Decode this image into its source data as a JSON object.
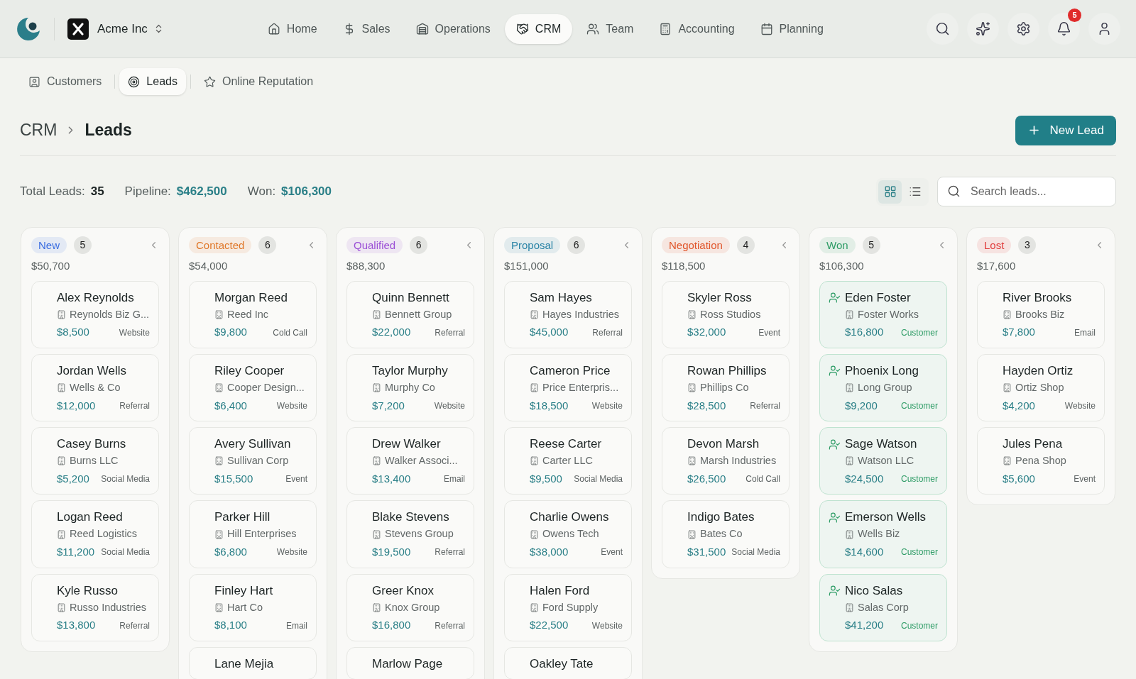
{
  "org": {
    "name": "Acme Inc"
  },
  "nav": [
    {
      "label": "Home",
      "kind": "home",
      "selected": false
    },
    {
      "label": "Sales",
      "kind": "dollar",
      "selected": false
    },
    {
      "label": "Operations",
      "kind": "warehouse",
      "selected": false
    },
    {
      "label": "CRM",
      "kind": "handshake",
      "selected": true
    },
    {
      "label": "Team",
      "kind": "users",
      "selected": false
    },
    {
      "label": "Accounting",
      "kind": "calculator",
      "selected": false
    },
    {
      "label": "Planning",
      "kind": "calendar",
      "selected": false
    }
  ],
  "notifications": {
    "count": "5"
  },
  "subnav": [
    {
      "label": "Customers",
      "kind": "contact",
      "selected": false
    },
    {
      "label": "Leads",
      "kind": "target",
      "selected": true
    },
    {
      "label": "Online Reputation",
      "kind": "star",
      "selected": false
    }
  ],
  "breadcrumb": [
    "CRM",
    "Leads"
  ],
  "new_button": "New Lead",
  "stats": [
    {
      "label": "Total Leads:",
      "value": "35",
      "kind": "plain"
    },
    {
      "label": "Pipeline:",
      "value": "$462,500",
      "kind": "money"
    },
    {
      "label": "Won:",
      "value": "$106,300",
      "kind": "money"
    }
  ],
  "view": [
    {
      "kind": "grid",
      "selected": true
    },
    {
      "kind": "list",
      "selected": false
    }
  ],
  "search": {
    "placeholder": "Search leads..."
  },
  "columns": [
    {
      "name": "New",
      "color": "#3b6ee0",
      "count": "5",
      "total": "$50,700",
      "cards": [
        {
          "name": "Alex Reynolds",
          "company": "Reynolds Biz G...",
          "value": "$8,500",
          "source": "Website",
          "converted": false
        },
        {
          "name": "Jordan Wells",
          "company": "Wells & Co",
          "value": "$12,000",
          "source": "Referral",
          "converted": false
        },
        {
          "name": "Casey Burns",
          "company": "Burns LLC",
          "value": "$5,200",
          "source": "Social Media",
          "converted": false
        },
        {
          "name": "Logan Reed",
          "company": "Reed Logistics",
          "value": "$11,200",
          "source": "Social Media",
          "converted": false
        },
        {
          "name": "Kyle Russo",
          "company": "Russo Industries",
          "value": "$13,800",
          "source": "Referral",
          "converted": false
        }
      ]
    },
    {
      "name": "Contacted",
      "color": "#e0782a",
      "count": "6",
      "total": "$54,000",
      "cards": [
        {
          "name": "Morgan Reed",
          "company": "Reed Inc",
          "value": "$9,800",
          "source": "Cold Call",
          "converted": false
        },
        {
          "name": "Riley Cooper",
          "company": "Cooper Design...",
          "value": "$6,400",
          "source": "Website",
          "converted": false
        },
        {
          "name": "Avery Sullivan",
          "company": "Sullivan Corp",
          "value": "$15,500",
          "source": "Event",
          "converted": false
        },
        {
          "name": "Parker Hill",
          "company": "Hill Enterprises",
          "value": "$6,800",
          "source": "Website",
          "converted": false
        },
        {
          "name": "Finley Hart",
          "company": "Hart Co",
          "value": "$8,100",
          "source": "Email",
          "converted": false
        },
        {
          "name": "Lane Mejia",
          "converted": false
        }
      ]
    },
    {
      "name": "Qualified",
      "color": "#9b4fd6",
      "count": "6",
      "total": "$88,300",
      "cards": [
        {
          "name": "Quinn Bennett",
          "company": "Bennett Group",
          "value": "$22,000",
          "source": "Referral",
          "converted": false
        },
        {
          "name": "Taylor Murphy",
          "company": "Murphy Co",
          "value": "$7,200",
          "source": "Website",
          "converted": false
        },
        {
          "name": "Drew Walker",
          "company": "Walker Associ...",
          "value": "$13,400",
          "source": "Email",
          "converted": false
        },
        {
          "name": "Blake Stevens",
          "company": "Stevens Group",
          "value": "$19,500",
          "source": "Referral",
          "converted": false
        },
        {
          "name": "Greer Knox",
          "company": "Knox Group",
          "value": "$16,800",
          "source": "Referral",
          "converted": false
        },
        {
          "name": "Marlow Page",
          "converted": false
        }
      ]
    },
    {
      "name": "Proposal",
      "color": "#2a84a6",
      "count": "6",
      "total": "$151,000",
      "cards": [
        {
          "name": "Sam Hayes",
          "company": "Hayes Industries",
          "value": "$45,000",
          "source": "Referral",
          "converted": false
        },
        {
          "name": "Cameron Price",
          "company": "Price Enterpris...",
          "value": "$18,500",
          "source": "Website",
          "converted": false
        },
        {
          "name": "Reese Carter",
          "company": "Carter LLC",
          "value": "$9,500",
          "source": "Social Media",
          "converted": false
        },
        {
          "name": "Charlie Owens",
          "company": "Owens Tech",
          "value": "$38,000",
          "source": "Event",
          "converted": false
        },
        {
          "name": "Halen Ford",
          "company": "Ford Supply",
          "value": "$22,500",
          "source": "Website",
          "converted": false
        },
        {
          "name": "Oakley Tate",
          "converted": false
        }
      ]
    },
    {
      "name": "Negotiation",
      "color": "#e0552a",
      "count": "4",
      "total": "$118,500",
      "cards": [
        {
          "name": "Skyler Ross",
          "company": "Ross Studios",
          "value": "$32,000",
          "source": "Event",
          "converted": false
        },
        {
          "name": "Rowan Phillips",
          "company": "Phillips Co",
          "value": "$28,500",
          "source": "Referral",
          "converted": false
        },
        {
          "name": "Devon Marsh",
          "company": "Marsh Industries",
          "value": "$26,500",
          "source": "Cold Call",
          "converted": false
        },
        {
          "name": "Indigo Bates",
          "company": "Bates Co",
          "value": "$31,500",
          "source": "Social Media",
          "converted": false
        }
      ]
    },
    {
      "name": "Won",
      "color": "#2e9c66",
      "count": "5",
      "total": "$106,300",
      "cards": [
        {
          "name": "Eden Foster",
          "company": "Foster Works",
          "value": "$16,800",
          "source": "Customer",
          "converted": true
        },
        {
          "name": "Phoenix Long",
          "company": "Long Group",
          "value": "$9,200",
          "source": "Customer",
          "converted": true
        },
        {
          "name": "Sage Watson",
          "company": "Watson LLC",
          "value": "$24,500",
          "source": "Customer",
          "converted": true
        },
        {
          "name": "Emerson Wells",
          "company": "Wells Biz",
          "value": "$14,600",
          "source": "Customer",
          "converted": true
        },
        {
          "name": "Nico Salas",
          "company": "Salas Corp",
          "value": "$41,200",
          "source": "Customer",
          "converted": true
        }
      ]
    },
    {
      "name": "Lost",
      "color": "#e03a3a",
      "count": "3",
      "total": "$17,600",
      "cards": [
        {
          "name": "River Brooks",
          "company": "Brooks Biz",
          "value": "$7,800",
          "source": "Email",
          "converted": false
        },
        {
          "name": "Hayden Ortiz",
          "company": "Ortiz Shop",
          "value": "$4,200",
          "source": "Website",
          "converted": false
        },
        {
          "name": "Jules Pena",
          "company": "Pena Shop",
          "value": "$5,600",
          "source": "Event",
          "converted": false
        }
      ]
    }
  ]
}
